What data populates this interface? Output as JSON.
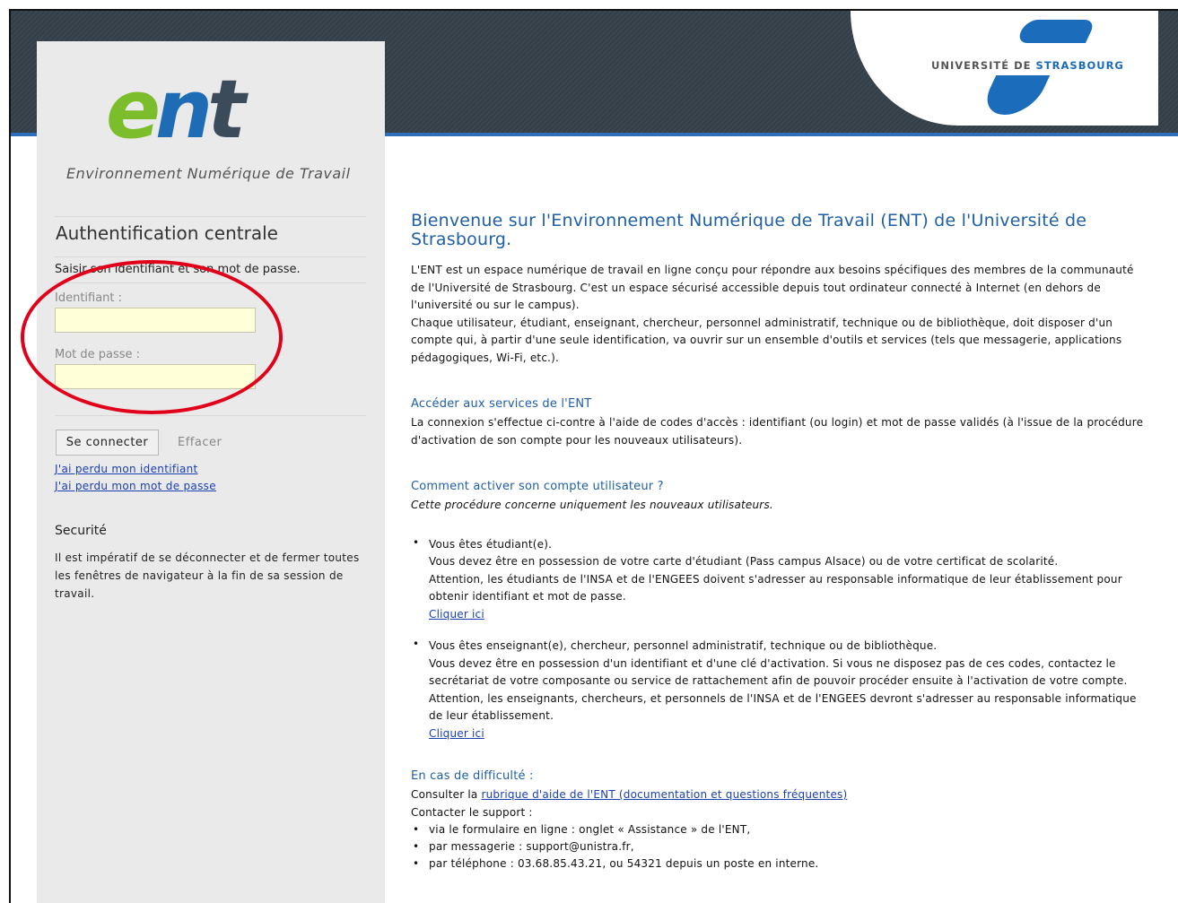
{
  "brand": {
    "unistra_prefix": "UNIVERSITÉ DE ",
    "unistra_suffix": "STRASBOURG",
    "logo_e": "e",
    "logo_n": "n",
    "logo_t": "t",
    "logo_subtitle": "Environnement Numérique de Travail"
  },
  "login": {
    "title": "Authentification centrale",
    "hint": "Saisir son identifiant et son mot de passe.",
    "username_label": "Identifiant :",
    "username_value": "",
    "password_label": "Mot de passe :",
    "password_value": "",
    "submit_label": "Se connecter",
    "clear_label": "Effacer",
    "lost_id_link": "J'ai perdu mon identifiant",
    "lost_pw_link": "J'ai perdu mon mot de passe"
  },
  "security": {
    "title": "Securité",
    "text": "Il est impératif de se déconnecter et de fermer toutes les fenêtres de navigateur à la fin de sa session de travail."
  },
  "main": {
    "welcome_title": "Bienvenue sur l'Environnement Numérique de Travail (ENT) de l'Université de Strasbourg.",
    "intro_1": "L'ENT est un espace numérique de travail en ligne conçu pour répondre aux besoins spécifiques des membres de la communauté de l'Université de Strasbourg. C'est un espace sécurisé accessible depuis tout ordinateur connecté à Internet (en dehors de l'université ou sur le campus).",
    "intro_2": "Chaque utilisateur, étudiant, enseignant, chercheur, personnel administratif, technique ou de bibliothèque, doit disposer d'un compte qui, à partir d'une seule identification, va ouvrir sur un ensemble d'outils et services (tels que messagerie, applications pédagogiques, Wi-Fi, etc.).",
    "access_title": "Accéder aux services de l'ENT",
    "access_text": "La connexion s'effectue ci-contre à l'aide de codes d'accès : identifiant (ou login) et mot de passe validés (à l'issue de la procédure d'activation de son compte pour les nouveaux utilisateurs).",
    "activate_title": "Comment activer son compte utilisateur ?",
    "activate_note": "Cette procédure concerne uniquement les nouveaux utilisateurs.",
    "students_title": "Vous êtes étudiant(e).",
    "students_text_1": "Vous devez être en possession de votre carte d'étudiant (Pass campus Alsace) ou de votre certificat de scolarité.",
    "students_text_2": "Attention, les étudiants de l'INSA et de l'ENGEES doivent s'adresser au responsable informatique de leur établissement pour obtenir identifiant et mot de passe.",
    "students_link": "Cliquer ici",
    "staff_title": "Vous êtes enseignant(e), chercheur, personnel administratif, technique ou de bibliothèque.",
    "staff_text_1": "Vous devez être en possession d'un identifiant et d'une clé d'activation. Si vous ne disposez pas de ces codes, contactez le secrétariat de votre composante ou service de rattachement afin de pouvoir procéder ensuite à l'activation de votre compte.",
    "staff_text_2": "Attention, les enseignants, chercheurs, et personnels de l'INSA et de l'ENGEES devront s'adresser au responsable informatique de leur établissement.",
    "staff_link": "Cliquer ici",
    "help_title": "En cas de difficulté :",
    "help_consult_prefix": "Consulter la ",
    "help_consult_link": "rubrique d'aide de l'ENT (documentation et questions fréquentes)",
    "help_contact": "Contacter le support :",
    "help_items": [
      "via le formulaire en ligne : onglet « Assistance » de l'ENT,",
      "par messagerie : support@unistra.fr,",
      "par téléphone : 03.68.85.43.21, ou 54321 depuis un poste en interne."
    ]
  }
}
